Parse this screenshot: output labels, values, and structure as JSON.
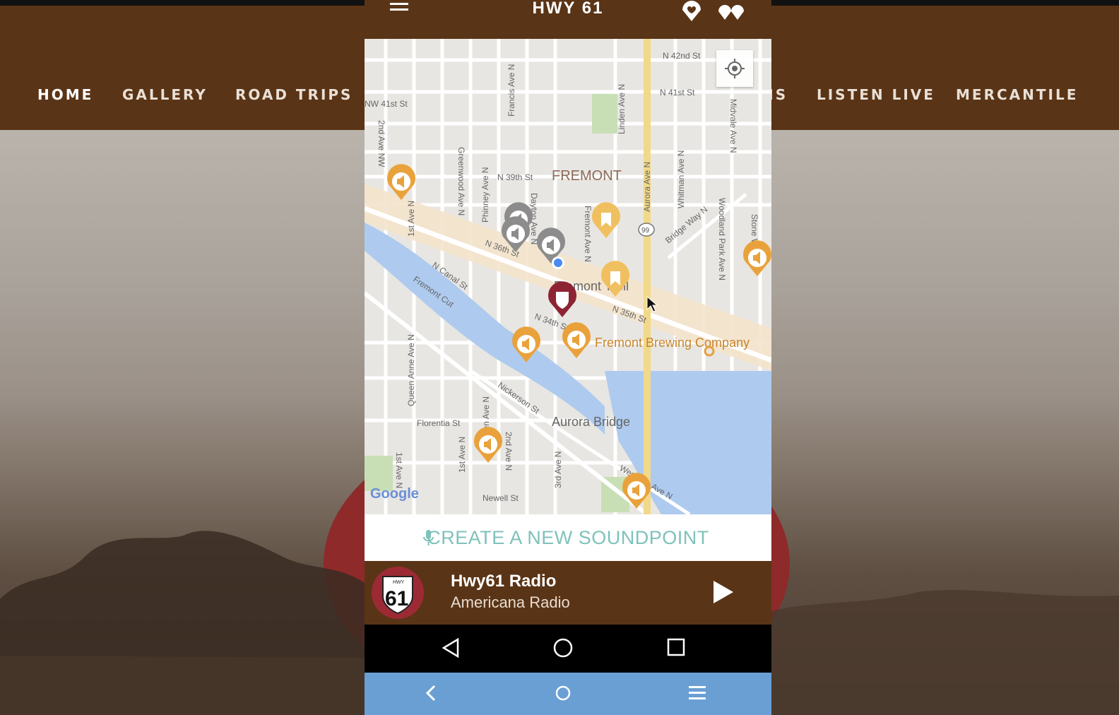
{
  "site": {
    "nav": [
      "HOME",
      "GALLERY",
      "ROAD TRIPS",
      "NS",
      "LISTEN LIVE",
      "MERCANTILE"
    ]
  },
  "app": {
    "title": "HWY 61",
    "header_icons": [
      "hamburger-menu-icon",
      "location-heart-icon",
      "pins-icon"
    ],
    "locate_icon": "crosshair-icon"
  },
  "map": {
    "streets": [
      "N 42nd St",
      "N 41st St",
      "NW 41st St",
      "2nd Ave NW",
      "Francis Ave N",
      "Linden Ave N",
      "Aurora Ave N",
      "Whitman Ave N",
      "Midvale Ave N",
      "N 39th St",
      "Greenwood Ave N",
      "Phinney Ave N",
      "Dayton Ave N",
      "1st Ave N",
      "Fremont Ave N",
      "Bridge Way N",
      "Woodland Park Ave N",
      "Stone Way",
      "N 36th St",
      "N Canal St",
      "Fremont Cut",
      "N 34th St",
      "N 35th St",
      "Queen Anne Ave N",
      "Nickerson St",
      "Florentia St",
      "Warren Ave N",
      "1st Ave N",
      "2nd Ave N",
      "3rd Ave N",
      "Westlake Ave N",
      "Newell St",
      "1st Ave N"
    ],
    "district": "FREMONT",
    "highway_shield": "99",
    "pois": [
      "Fremont Troll",
      "Fremont Brewing Company",
      "Aurora Bridge"
    ],
    "attribution": "Google"
  },
  "create": {
    "label": "CREATE A NEW SOUNDPOINT",
    "icon": "microphone-icon"
  },
  "player": {
    "logo_number": "61",
    "logo_top": "HWY",
    "title": "Hwy61 Radio",
    "subtitle": "Americana Radio",
    "play_icon": "play-icon"
  },
  "android_nav": [
    "back-icon",
    "home-icon",
    "recents-icon"
  ],
  "browser_nav": [
    "browser-back-icon",
    "browser-home-icon",
    "browser-menu-icon"
  ]
}
